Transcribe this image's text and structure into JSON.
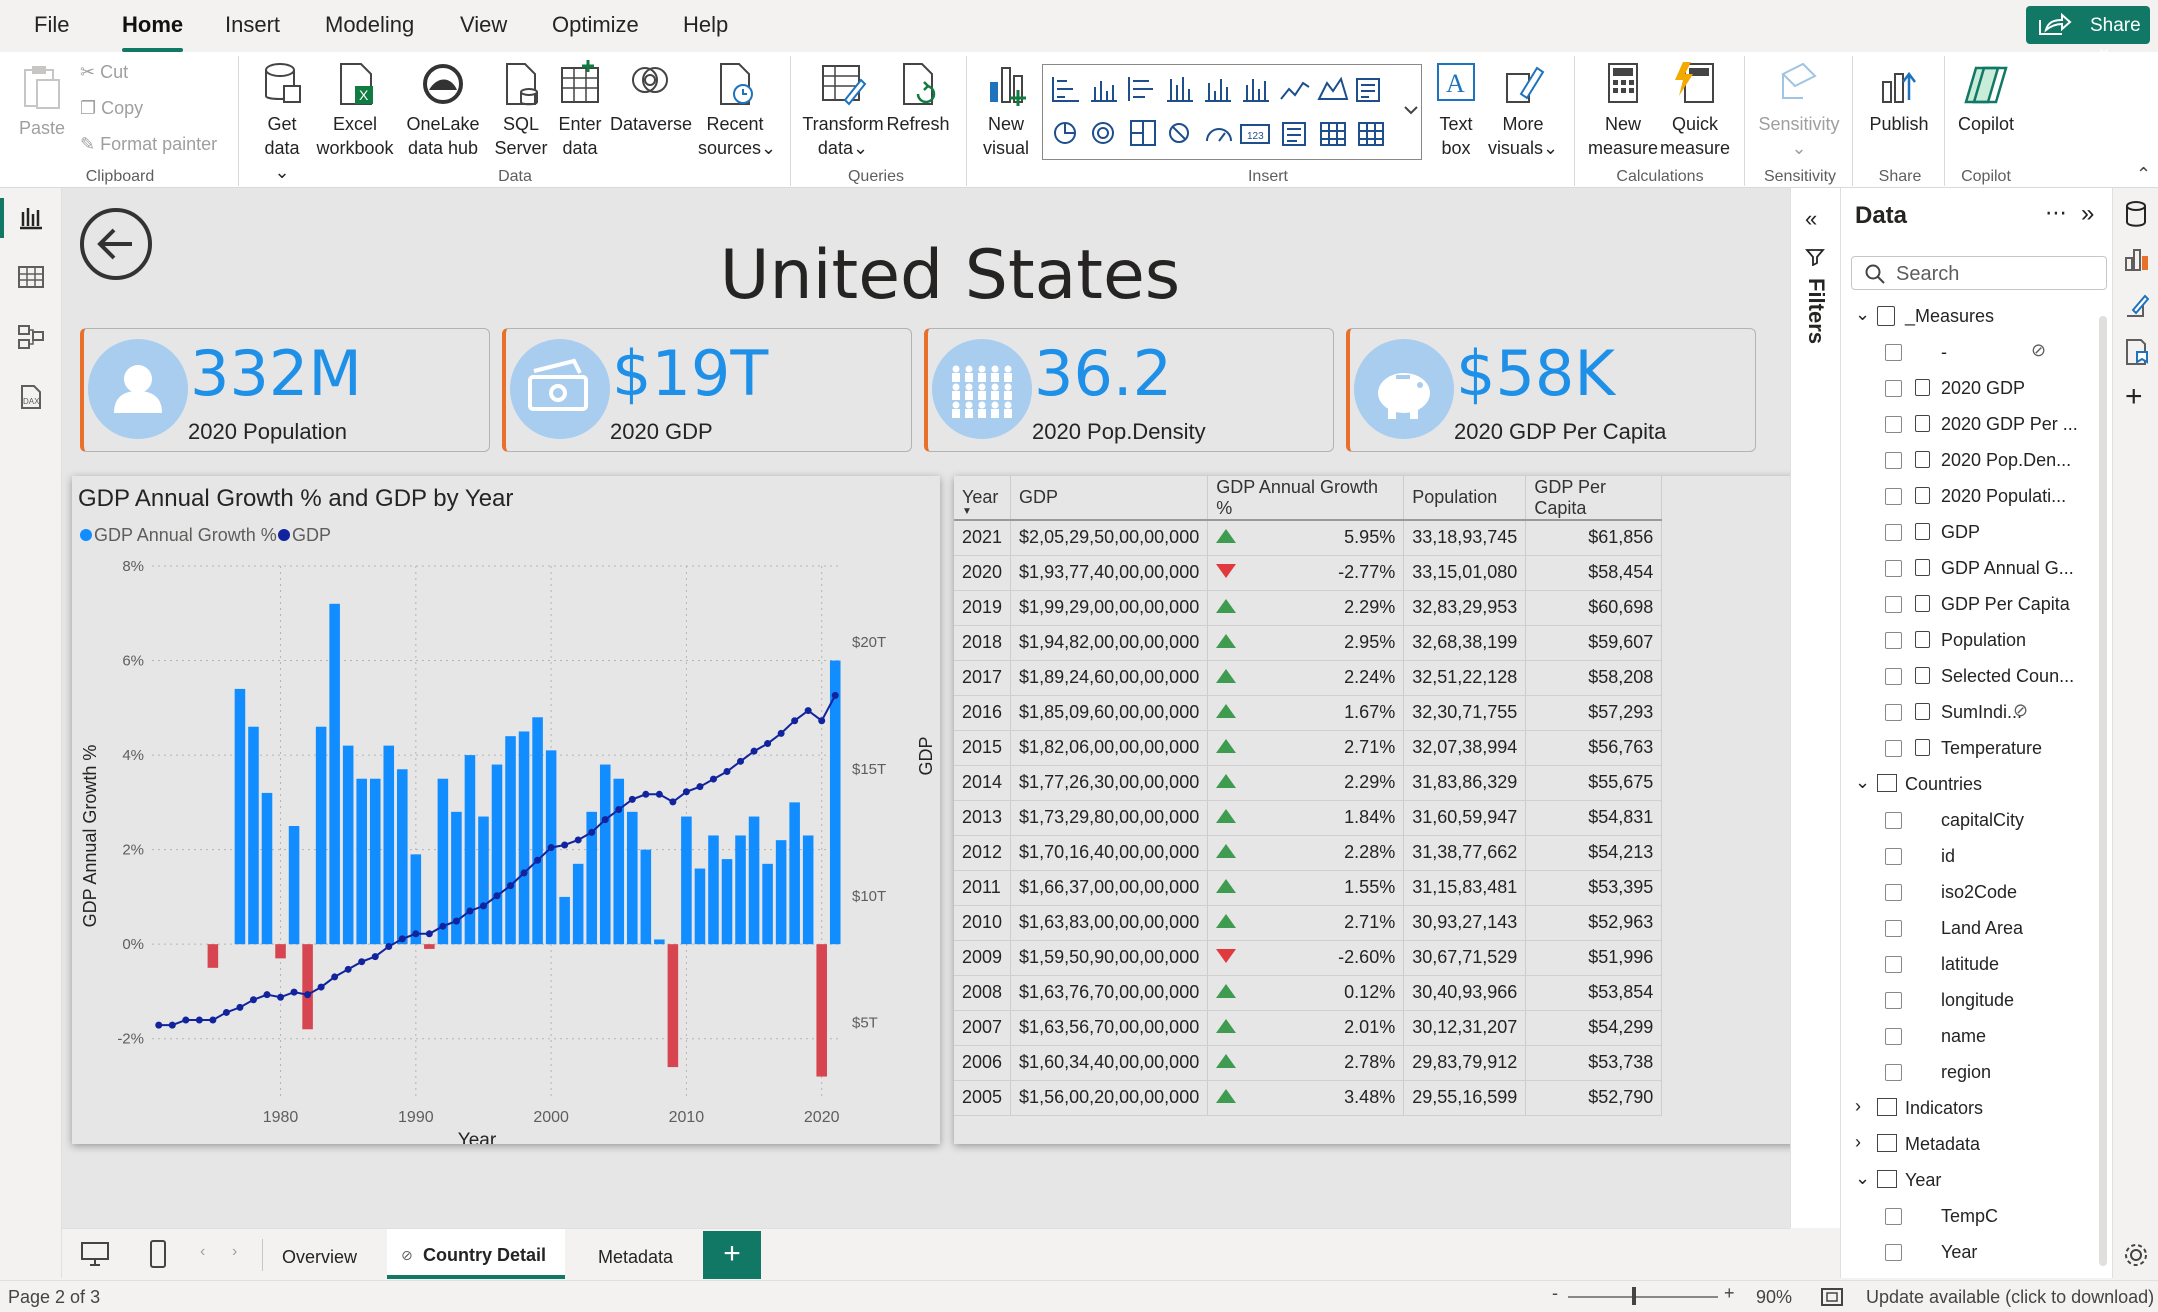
{
  "menu": {
    "items": [
      "File",
      "Home",
      "Insert",
      "Modeling",
      "View",
      "Optimize",
      "Help"
    ],
    "active": "Home",
    "share": "Share"
  },
  "ribbon": {
    "clipboard": {
      "paste": "Paste",
      "cut": "Cut",
      "copy": "Copy",
      "format_painter": "Format painter",
      "group": "Clipboard"
    },
    "data": {
      "get_data": "Get data",
      "excel": "Excel workbook",
      "onelake": "OneLake data hub",
      "sql": "SQL Server",
      "enter": "Enter data",
      "dataverse": "Dataverse",
      "recent": "Recent sources",
      "group": "Data"
    },
    "queries": {
      "transform": "Transform data",
      "refresh": "Refresh",
      "group": "Queries"
    },
    "insert": {
      "new_visual": "New visual",
      "text_box": "Text box",
      "more_visuals": "More visuals",
      "group": "Insert"
    },
    "calculations": {
      "new_measure": "New measure",
      "quick_measure": "Quick measure",
      "group": "Calculations"
    },
    "sensitivity": {
      "label": "Sensitivity",
      "group": "Sensitivity"
    },
    "share": {
      "publish": "Publish",
      "group": "Share"
    },
    "copilot": {
      "label": "Copilot",
      "group": "Copilot"
    }
  },
  "report": {
    "title": "United States",
    "kpis": [
      {
        "value": "332M",
        "label": "2020 Population",
        "icon": "person-icon"
      },
      {
        "value": "$19T",
        "label": "2020 GDP",
        "icon": "money-icon"
      },
      {
        "value": "36.2",
        "label": "2020 Pop.Density",
        "icon": "crowd-icon"
      },
      {
        "value": "$58K",
        "label": "2020 GDP Per Capita",
        "icon": "piggy-bank-icon"
      }
    ]
  },
  "chart_data": {
    "type": "bar",
    "title": "GDP Annual Growth % and GDP by Year",
    "xlabel": "Year",
    "ylabel": "GDP Annual Growth %",
    "y2label": "GDP",
    "legend": [
      {
        "name": "GDP Annual Growth %",
        "color": "#118dff"
      },
      {
        "name": "GDP",
        "color": "#12239e"
      }
    ],
    "legend_position": "top-left",
    "ylim": [
      -3,
      8
    ],
    "yticks": [
      "8%",
      "6%",
      "4%",
      "2%",
      "0%",
      "-2%"
    ],
    "y2ticks": [
      "$20T",
      "$15T",
      "$10T",
      "$5T"
    ],
    "xticks": [
      "1980",
      "1990",
      "2000",
      "2010",
      "2020"
    ],
    "x": [
      1971,
      1972,
      1973,
      1974,
      1975,
      1976,
      1977,
      1978,
      1979,
      1980,
      1981,
      1982,
      1983,
      1984,
      1985,
      1986,
      1987,
      1988,
      1989,
      1990,
      1991,
      1992,
      1993,
      1994,
      1995,
      1996,
      1997,
      1998,
      1999,
      2000,
      2001,
      2002,
      2003,
      2004,
      2005,
      2006,
      2007,
      2008,
      2009,
      2010,
      2011,
      2012,
      2013,
      2014,
      2015,
      2016,
      2017,
      2018,
      2019,
      2020,
      2021
    ],
    "growth": [
      0,
      0,
      0,
      0,
      -0.5,
      0,
      5.4,
      4.6,
      3.2,
      -0.3,
      2.5,
      -1.8,
      4.6,
      7.2,
      4.2,
      3.5,
      3.5,
      4.2,
      3.7,
      1.9,
      -0.1,
      3.5,
      2.8,
      4.0,
      2.7,
      3.8,
      4.4,
      4.5,
      4.8,
      4.1,
      1.0,
      1.7,
      2.8,
      3.8,
      3.5,
      2.8,
      2.0,
      0.1,
      -2.6,
      2.7,
      1.6,
      2.3,
      1.8,
      2.3,
      2.7,
      1.7,
      2.2,
      3.0,
      2.3,
      -2.8,
      6.0
    ],
    "gdp_trillions": [
      4.9,
      4.9,
      5.1,
      5.1,
      5.1,
      5.4,
      5.6,
      5.9,
      6.1,
      6.0,
      6.2,
      6.1,
      6.4,
      6.8,
      7.1,
      7.4,
      7.6,
      8.0,
      8.3,
      8.5,
      8.5,
      8.8,
      9.0,
      9.4,
      9.6,
      10.0,
      10.4,
      10.9,
      11.4,
      11.9,
      12.0,
      12.2,
      12.5,
      13.0,
      13.4,
      13.8,
      14.0,
      14.0,
      13.7,
      14.1,
      14.3,
      14.6,
      14.9,
      15.3,
      15.7,
      16.0,
      16.4,
      16.9,
      17.3,
      16.9,
      17.9
    ]
  },
  "table": {
    "columns": [
      "Year",
      "GDP",
      "GDP Annual Growth %",
      "Population",
      "GDP Per Capita"
    ],
    "rows": [
      [
        "2021",
        "$2,05,29,50,00,00,000",
        "up",
        "5.95%",
        "33,18,93,745",
        "$61,856"
      ],
      [
        "2020",
        "$1,93,77,40,00,00,000",
        "down",
        "-2.77%",
        "33,15,01,080",
        "$58,454"
      ],
      [
        "2019",
        "$1,99,29,00,00,00,000",
        "up",
        "2.29%",
        "32,83,29,953",
        "$60,698"
      ],
      [
        "2018",
        "$1,94,82,00,00,00,000",
        "up",
        "2.95%",
        "32,68,38,199",
        "$59,607"
      ],
      [
        "2017",
        "$1,89,24,60,00,00,000",
        "up",
        "2.24%",
        "32,51,22,128",
        "$58,208"
      ],
      [
        "2016",
        "$1,85,09,60,00,00,000",
        "up",
        "1.67%",
        "32,30,71,755",
        "$57,293"
      ],
      [
        "2015",
        "$1,82,06,00,00,00,000",
        "up",
        "2.71%",
        "32,07,38,994",
        "$56,763"
      ],
      [
        "2014",
        "$1,77,26,30,00,00,000",
        "up",
        "2.29%",
        "31,83,86,329",
        "$55,675"
      ],
      [
        "2013",
        "$1,73,29,80,00,00,000",
        "up",
        "1.84%",
        "31,60,59,947",
        "$54,831"
      ],
      [
        "2012",
        "$1,70,16,40,00,00,000",
        "up",
        "2.28%",
        "31,38,77,662",
        "$54,213"
      ],
      [
        "2011",
        "$1,66,37,00,00,00,000",
        "up",
        "1.55%",
        "31,15,83,481",
        "$53,395"
      ],
      [
        "2010",
        "$1,63,83,00,00,00,000",
        "up",
        "2.71%",
        "30,93,27,143",
        "$52,963"
      ],
      [
        "2009",
        "$1,59,50,90,00,00,000",
        "down",
        "-2.60%",
        "30,67,71,529",
        "$51,996"
      ],
      [
        "2008",
        "$1,63,76,70,00,00,000",
        "up",
        "0.12%",
        "30,40,93,966",
        "$53,854"
      ],
      [
        "2007",
        "$1,63,56,70,00,00,000",
        "up",
        "2.01%",
        "30,12,31,207",
        "$54,299"
      ],
      [
        "2006",
        "$1,60,34,40,00,00,000",
        "up",
        "2.78%",
        "29,83,79,912",
        "$53,738"
      ],
      [
        "2005",
        "$1,56,00,20,00,00,000",
        "up",
        "3.48%",
        "29,55,16,599",
        "$52,790"
      ]
    ]
  },
  "filters_label": "Filters",
  "data_pane": {
    "title": "Data",
    "search_placeholder": "Search",
    "tables": [
      {
        "name": "_Measures",
        "expanded": true,
        "fields": [
          "-",
          "2020 GDP",
          "2020 GDP Per ...",
          "2020 Pop.Den...",
          "2020 Populati...",
          "GDP",
          "GDP Annual G...",
          "GDP Per Capita",
          "Population",
          "Selected Coun...",
          "SumIndi...",
          "Temperature"
        ]
      },
      {
        "name": "Countries",
        "expanded": true,
        "fields": [
          "capitalCity",
          "id",
          "iso2Code",
          "Land Area",
          "latitude",
          "longitude",
          "name",
          "region"
        ]
      },
      {
        "name": "Indicators",
        "expanded": false,
        "fields": []
      },
      {
        "name": "Metadata",
        "expanded": false,
        "fields": []
      },
      {
        "name": "Year",
        "expanded": true,
        "fields": [
          "TempC",
          "Year"
        ]
      }
    ]
  },
  "tabs": {
    "pages": [
      "Overview",
      "Country Detail",
      "Metadata"
    ],
    "active": "Country Detail"
  },
  "status": {
    "page": "Page 2 of 3",
    "zoom": "90%",
    "update": "Update available (click to download)"
  }
}
